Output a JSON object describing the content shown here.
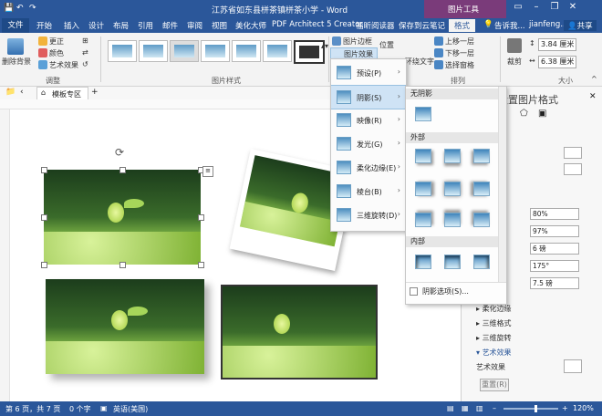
{
  "titlebar": {
    "doc_title": "江苏省如东县栟茶镇栟茶小学 - Word",
    "context_tools": "图片工具",
    "user": "jianfeng...",
    "share": "共享",
    "search_hint": "告诉我..."
  },
  "tabs": [
    "文件",
    "开始",
    "插入",
    "设计",
    "布局",
    "引用",
    "邮件",
    "审阅",
    "视图",
    "美化大师",
    "PDF Architect 5 Creator",
    "福昕阅读器",
    "保存到云笔记",
    "格式"
  ],
  "ribbon": {
    "remove_bg": "删除背景",
    "correction": "更正",
    "color": "颜色",
    "artistic": "艺术效果",
    "adjust_label": "调整",
    "styles_label": "图片样式",
    "border": "图片边框",
    "effects": "图片效果",
    "position": "位置",
    "wrap": "环绕文字",
    "forward": "上移一层",
    "backward": "下移一层",
    "selection_pane": "选择窗格",
    "arrange_label": "排列",
    "crop": "裁剪",
    "height": "3.84 厘米",
    "width": "6.38 厘米",
    "size_label": "大小"
  },
  "nav": {
    "tab_label": "模板专区"
  },
  "effects_menu": [
    "预设(P)",
    "阴影(S)",
    "映像(R)",
    "发光(G)",
    "柔化边缘(E)",
    "棱台(B)",
    "三维旋转(D)"
  ],
  "shadow_menu": {
    "no_shadow": "无阴影",
    "outer": "外部",
    "inner": "内部",
    "options": "阴影选项(S)..."
  },
  "pane": {
    "title": "设置图片格式",
    "fields": [
      "80%",
      "97%",
      "6 磅",
      "175°",
      "7.5 磅"
    ],
    "sections": [
      "柔化边缘",
      "三维格式",
      "三维旋转",
      "艺术效果"
    ],
    "art_label": "艺术效果",
    "reset": "重置(R)"
  },
  "status": {
    "page": "第 6 页，共 7 页",
    "words": "0 个字",
    "lang": "英语(美国)",
    "zoom": "120%"
  },
  "colors": {
    "accent": "#2b579a",
    "context": "#7a3b7a"
  }
}
